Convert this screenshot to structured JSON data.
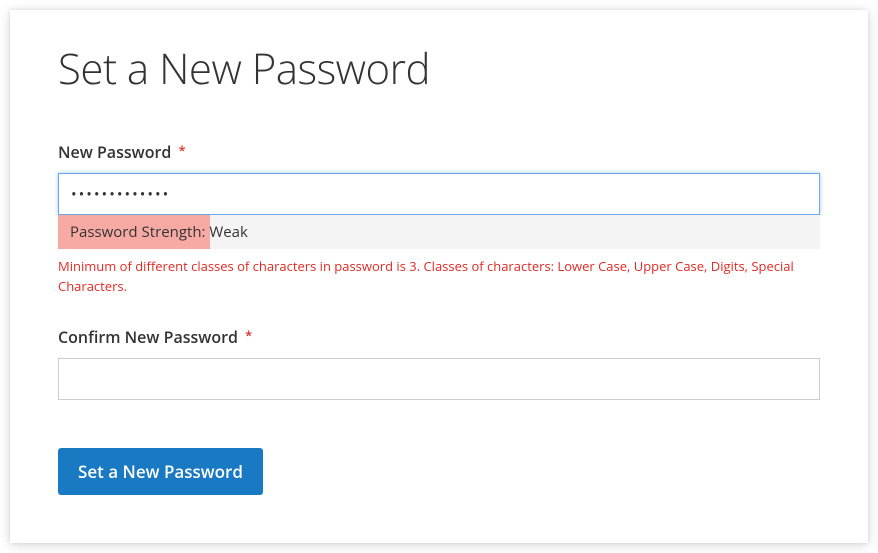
{
  "page": {
    "title": "Set a New Password"
  },
  "form": {
    "newPassword": {
      "label": "New Password",
      "requiredMark": "*",
      "value": "•••••••••••••",
      "strength": {
        "label": "Password Strength: Weak",
        "percent": 20,
        "barColor": "#f7a9a3"
      },
      "error": "Minimum of different classes of characters in password is 3. Classes of characters: Lower Case, Upper Case, Digits, Special Characters."
    },
    "confirmPassword": {
      "label": "Confirm New Password",
      "requiredMark": "*",
      "value": ""
    },
    "submit": {
      "label": "Set a New Password"
    }
  },
  "colors": {
    "accent": "#1979c3",
    "error": "#e02b27"
  }
}
